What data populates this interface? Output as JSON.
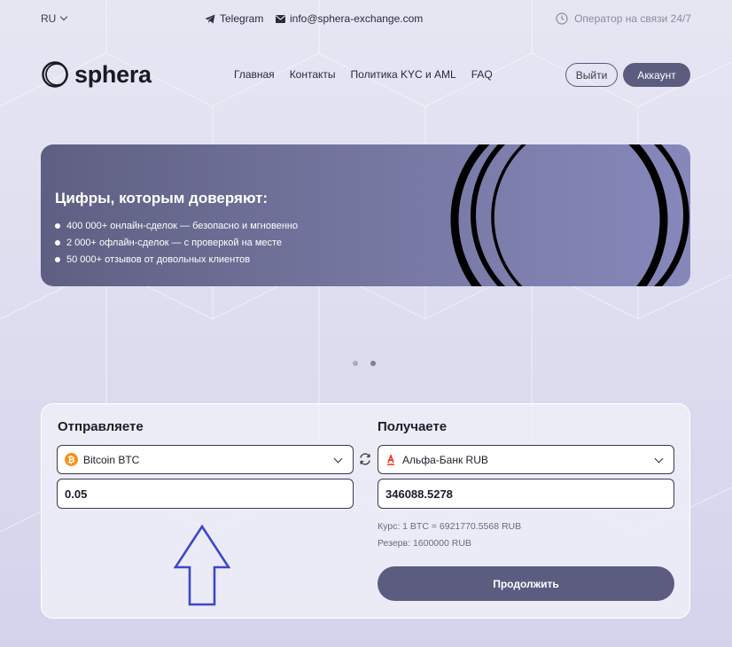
{
  "topbar": {
    "lang": "RU",
    "telegram": "Telegram",
    "email": "info@sphera-exchange.com",
    "support": "Оператор на связи 24/7"
  },
  "header": {
    "logo_text": "sphera",
    "nav": [
      "Главная",
      "Контакты",
      "Политика KYC и AML",
      "FAQ"
    ],
    "exit_label": "Выйти",
    "account_label": "Аккаунт"
  },
  "banner": {
    "title": "Цифры, которым доверяют:",
    "items": [
      "400 000+ онлайн-сделок — безопасно и мгновенно",
      "2 000+ офлайн-сделок — с проверкой на месте",
      "50 000+ отзывов от довольных клиентов"
    ]
  },
  "carousel": {
    "slides": 2,
    "active": 2
  },
  "exchange": {
    "send": {
      "title": "Отправляете",
      "currency": "Bitcoin BTC",
      "currency_icon": "bitcoin-icon",
      "amount": "0.05"
    },
    "receive": {
      "title": "Получаете",
      "currency": "Альфа-Банк RUB",
      "currency_icon": "alfa-bank-icon",
      "amount": "346088.5278",
      "rate": "Курс: 1 BTC = 6921770.5568 RUB",
      "reserve": "Резерв: 1600000 RUB"
    },
    "continue_label": "Продолжить"
  },
  "colors": {
    "accent": "#5b5c80",
    "bitcoin": "#f7931a",
    "alfa": "#ef3124",
    "annotation_arrow": "#3c48c8"
  }
}
